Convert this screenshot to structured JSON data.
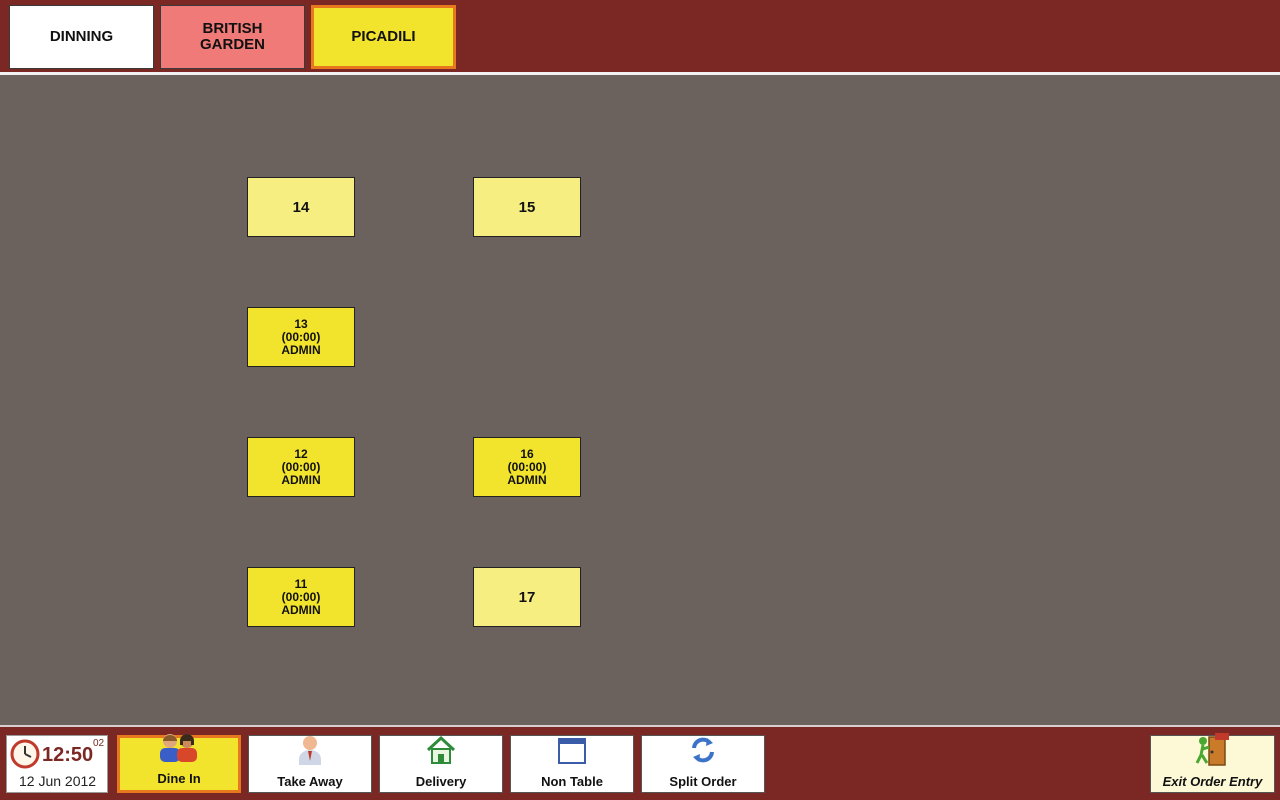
{
  "area_tabs": [
    {
      "label": "DINNING",
      "color": "#ffffff",
      "selected": false
    },
    {
      "label": "BRITISH\nGARDEN",
      "color": "#f07a78",
      "selected": false
    },
    {
      "label": "PICADILI",
      "color": "#f2e42c",
      "selected": true
    }
  ],
  "tables": [
    {
      "number": "14",
      "status": "free"
    },
    {
      "number": "15",
      "status": "free"
    },
    {
      "number": "13",
      "time": "(00:00)",
      "user": "ADMIN",
      "status": "occupied"
    },
    {
      "number": "12",
      "time": "(00:00)",
      "user": "ADMIN",
      "status": "occupied"
    },
    {
      "number": "16",
      "time": "(00:00)",
      "user": "ADMIN",
      "status": "occupied"
    },
    {
      "number": "11",
      "time": "(00:00)",
      "user": "ADMIN",
      "status": "occupied"
    },
    {
      "number": "17",
      "status": "free"
    }
  ],
  "clock": {
    "time": "12:50",
    "seconds": "02",
    "date": "12 Jun 2012",
    "icon": "clock-icon"
  },
  "order_modes": [
    {
      "label": "Dine In",
      "icon": "dine-in-people-icon",
      "selected": true
    },
    {
      "label": "Take Away",
      "icon": "person-icon",
      "selected": false
    },
    {
      "label": "Delivery",
      "icon": "home-icon",
      "selected": false
    },
    {
      "label": "Non Table",
      "icon": "window-icon",
      "selected": false
    },
    {
      "label": "Split Order",
      "icon": "refresh-arrows-icon",
      "selected": false
    }
  ],
  "exit": {
    "label": "Exit Order Entry",
    "icon": "exit-door-icon"
  },
  "colors": {
    "bar": "#7b2824",
    "floor": "#6b625e",
    "table_free": "#f7ee82",
    "table_busy": "#f2e42c",
    "selected_border": "#e8781e"
  }
}
